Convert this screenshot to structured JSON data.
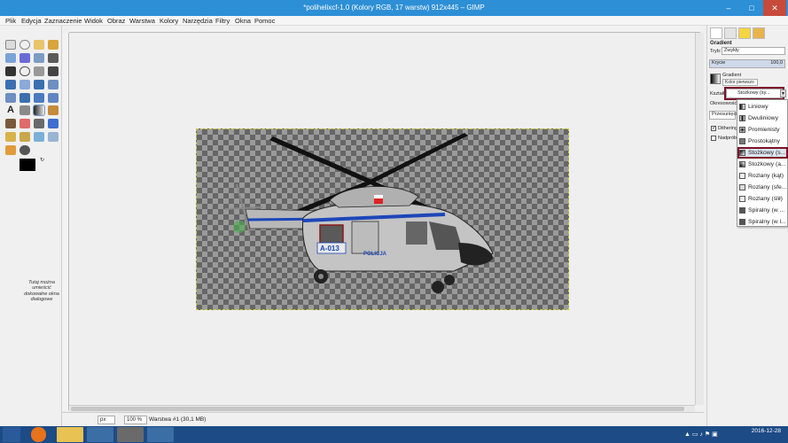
{
  "window": {
    "title": "*polihelixcf-1.0 (Kolory RGB, 17 warstw) 912x445 – GIMP",
    "minimize": "–",
    "maximize": "□",
    "close": "✕"
  },
  "menu": [
    "Plik",
    "Edycja",
    "Zaznaczenie",
    "Widok",
    "Obraz",
    "Warstwa",
    "Kolory",
    "Narzędzia",
    "Filtry",
    "Okna",
    "Pomoc"
  ],
  "toolbox": {
    "hint": "Tutaj można umieścić dokowalne okna dialogowe"
  },
  "canvas": {
    "helicopter_texts": [
      "A-013",
      "POLICJA"
    ]
  },
  "statusbar": {
    "unit": "px",
    "zoom": "100 %",
    "layer_info": "Warstwa #1 (30,1 MB)"
  },
  "dock": {
    "panel_title": "Gradient",
    "mode_label": "Tryb:",
    "mode_value": "Zwykły",
    "opacity_label": "Krycie",
    "opacity_value": "100,0",
    "gradient_label": "Gradient",
    "gradient_value": "Kolor pierwszo",
    "shape_label": "Kształt",
    "shape_value": "Stożkowy (sy...",
    "repeat_label": "Okresowość",
    "offset_label": "Przesunięcie",
    "dithering_label": "Dithering",
    "adaptive_label": "Nadpróbk"
  },
  "shape_options": [
    "Liniowy",
    "Dwuliniowy",
    "Promienisty",
    "Prostokątny",
    "Stożkowy (s...",
    "Stożkowy (a...",
    "Rozlany (kąt)",
    "Rozlany (sfe...",
    "Rozlany (ślił)",
    "Spiralny (w ...",
    "Spiralny (w l..."
  ],
  "taskbar": {
    "time": "",
    "date": "2016-12-28"
  },
  "colors": {
    "titlebar": "#2d8fd6",
    "taskbar": "#1d4b86",
    "highlight": "#7a1029"
  }
}
